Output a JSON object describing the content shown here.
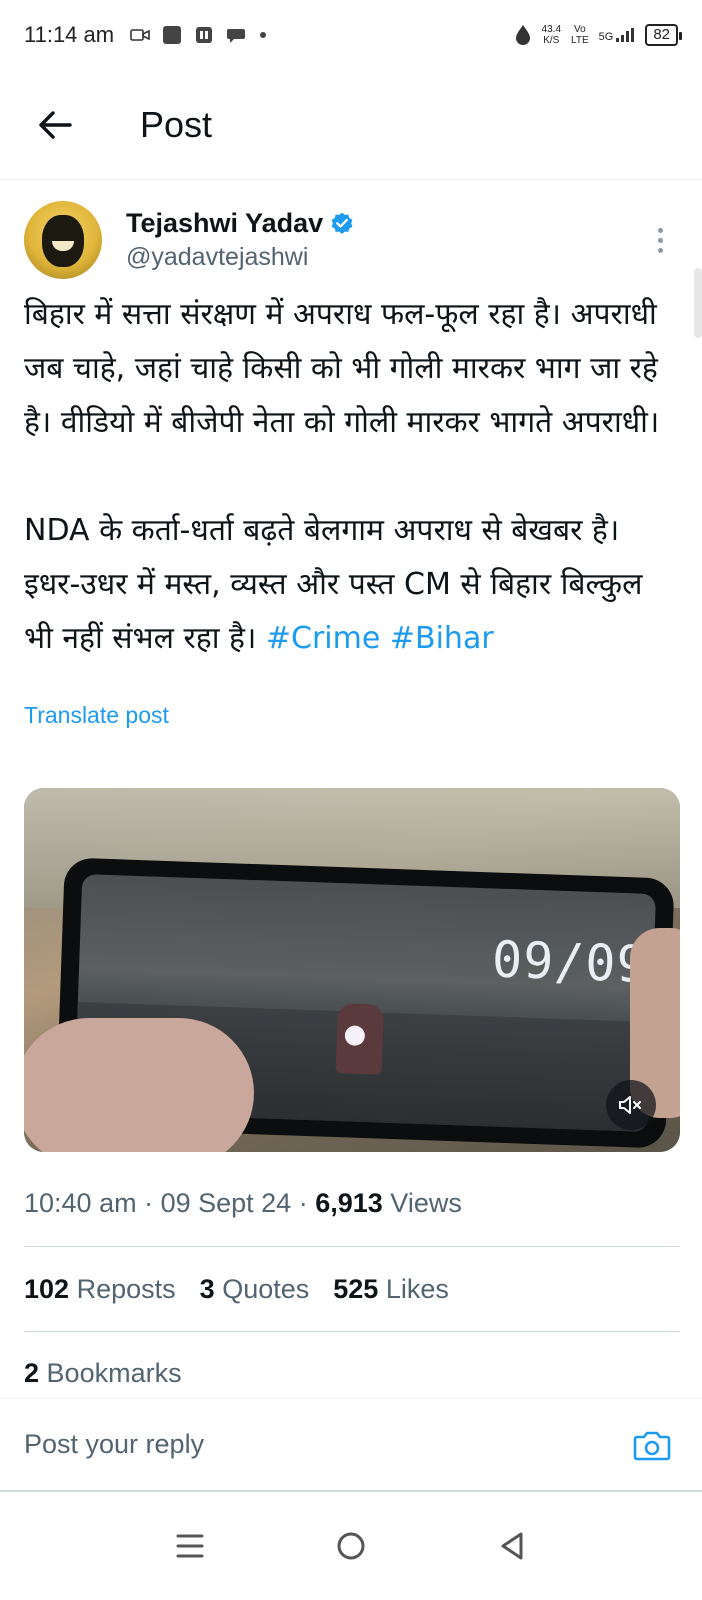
{
  "status_bar": {
    "time": "11:14 am",
    "net_speed_top": "43.4",
    "net_speed_bottom": "K/S",
    "volte_top": "Vo",
    "volte_bottom": "LTE",
    "network": "5G",
    "battery": "82"
  },
  "header": {
    "title": "Post"
  },
  "author": {
    "name": "Tejashwi Yadav",
    "handle": "@yadavtejashwi",
    "verified": true
  },
  "post": {
    "paragraph1": "बिहार में सत्ता संरक्षण में अपराध फल-फूल रहा है। अपराधी जब चाहे, जहां चाहे किसी को भी गोली मारकर भाग जा रहे है। वीडियो में बीजेपी नेता को गोली मारकर भागते अपराधी।",
    "paragraph2": "NDA के कर्ता-धर्ता बढ़ते बेलगाम अपराध से बेखबर है। इधर-उधर में मस्त, व्यस्त और पस्त CM से बिहार बिल्कुल भी नहीं संभल रहा है।",
    "hashtags": [
      "#Crime",
      "#Bihar"
    ],
    "translate_label": "Translate post"
  },
  "media": {
    "video_timestamp_text": "09/09",
    "mute_icon": "speaker-muted-icon"
  },
  "meta": {
    "time": "10:40 am",
    "date": "09 Sept 24",
    "views_count": "6,913",
    "views_label": "Views"
  },
  "stats": {
    "reposts_count": "102",
    "reposts_label": "Reposts",
    "quotes_count": "3",
    "quotes_label": "Quotes",
    "likes_count": "525",
    "likes_label": "Likes",
    "bookmarks_count": "2",
    "bookmarks_label": "Bookmarks"
  },
  "reply": {
    "placeholder": "Post your reply"
  },
  "colors": {
    "link": "#1d9bf0",
    "secondary_text": "#536471",
    "primary_text": "#0f1419"
  }
}
